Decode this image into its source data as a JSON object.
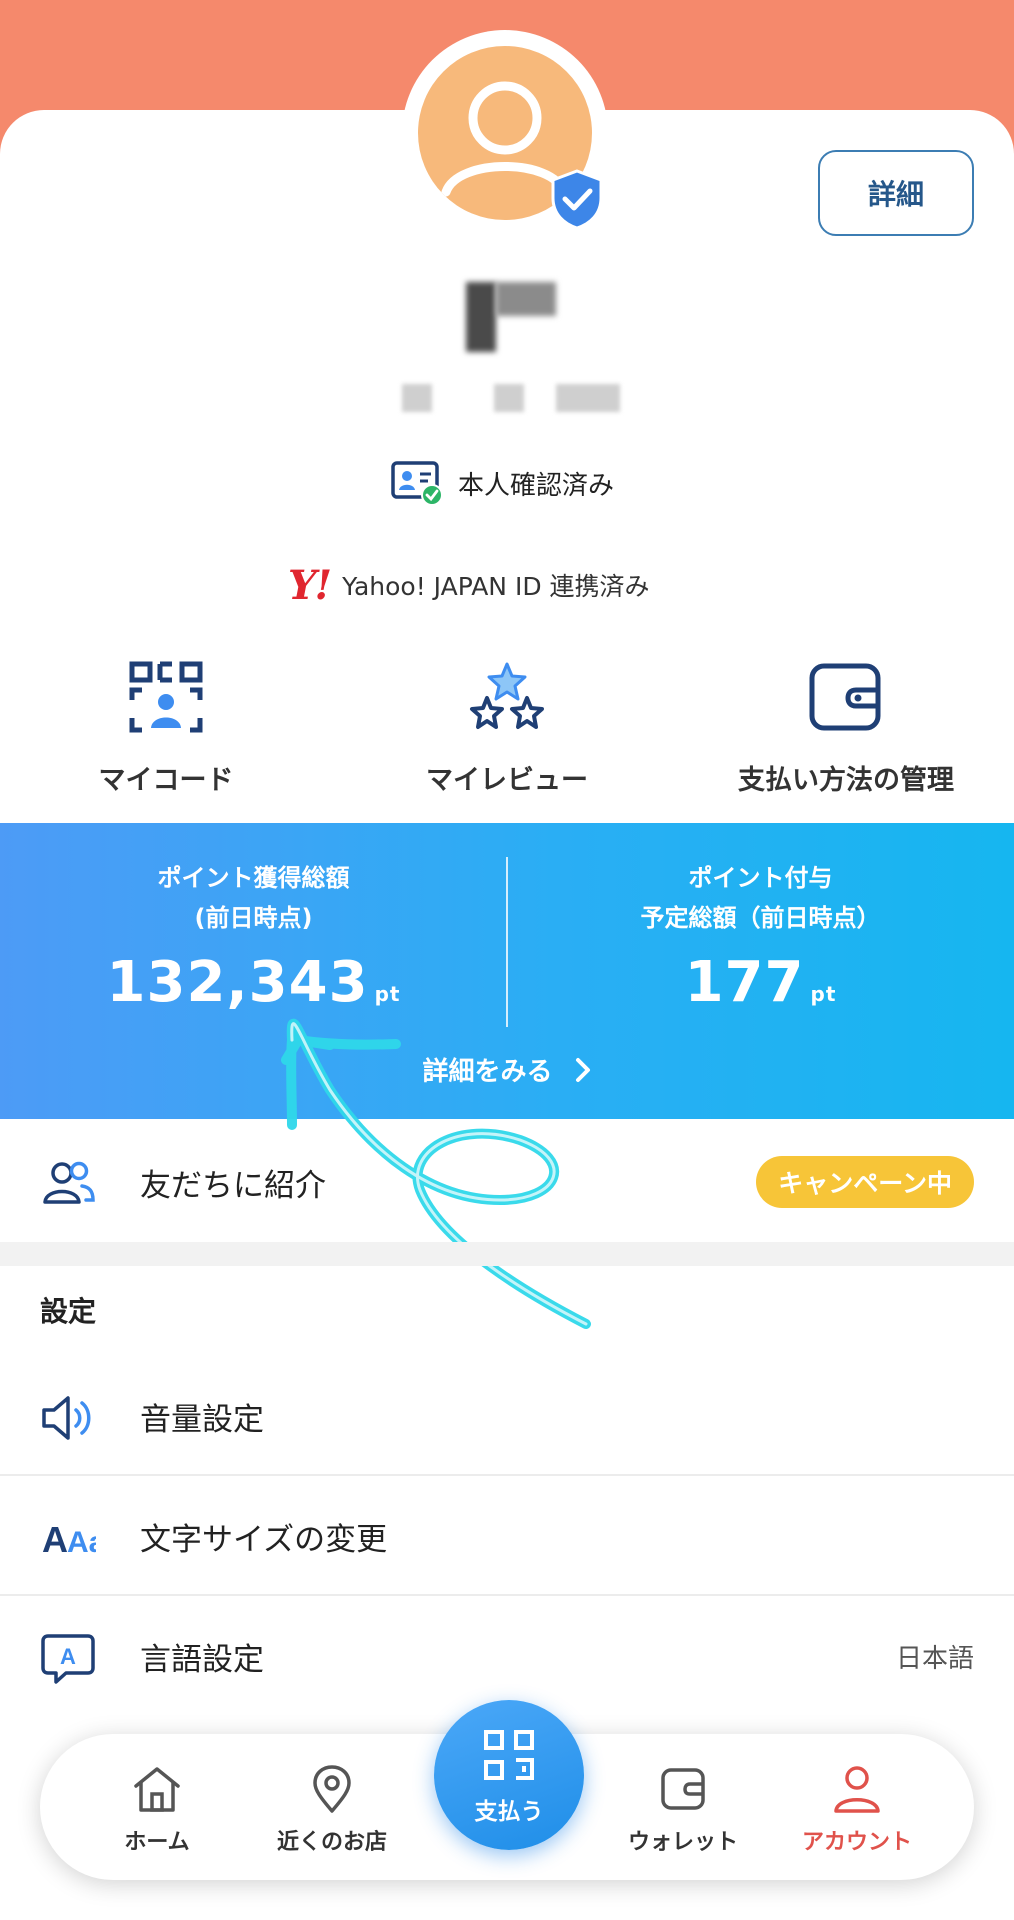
{
  "profile": {
    "detail_button": "詳細",
    "identity_status": "本人確認済み",
    "yahoo_logo": "Y!",
    "yahoo_status": "Yahoo! JAPAN ID 連携済み"
  },
  "quick_actions": [
    {
      "label": "マイコード",
      "icon": "my-code-icon"
    },
    {
      "label": "マイレビュー",
      "icon": "stars-icon"
    },
    {
      "label": "支払い方法の管理",
      "icon": "wallet-icon"
    }
  ],
  "points": {
    "earned_title_line1": "ポイント獲得総額",
    "earned_title_line2": "(前日時点)",
    "earned_value": "132,343",
    "earned_unit": "pt",
    "scheduled_title_line1": "ポイント付与",
    "scheduled_title_line2": "予定総額（前日時点）",
    "scheduled_value": "177",
    "scheduled_unit": "pt",
    "more_link": "詳細をみる",
    "gradient_start": "#4d9bf6",
    "gradient_end": "#16b6f0"
  },
  "referral": {
    "label": "友だちに紹介",
    "badge": "キャンペーン中",
    "badge_color": "#f7c538"
  },
  "settings": {
    "section_title": "設定",
    "items": [
      {
        "label": "音量設定",
        "icon": "speaker-icon",
        "value": ""
      },
      {
        "label": "文字サイズの変更",
        "icon": "font-size-icon",
        "icon_text": "Aa",
        "value": ""
      },
      {
        "label": "言語設定",
        "icon": "language-icon",
        "icon_text": "A",
        "value": "日本語"
      }
    ]
  },
  "bottom_nav": {
    "items": [
      {
        "label": "ホーム",
        "icon": "home-icon"
      },
      {
        "label": "近くのお店",
        "icon": "location-pin-icon"
      },
      {
        "label": "支払う",
        "icon": "qr-pay-icon"
      },
      {
        "label": "ウォレット",
        "icon": "wallet-icon"
      },
      {
        "label": "アカウント",
        "icon": "person-icon",
        "active": true
      }
    ],
    "active_color": "#e0524b"
  },
  "colors": {
    "header_band": "#f5896c",
    "avatar": "#f7b97b",
    "brand_navy": "#1f3f75",
    "accent_blue": "#3e8df0"
  }
}
